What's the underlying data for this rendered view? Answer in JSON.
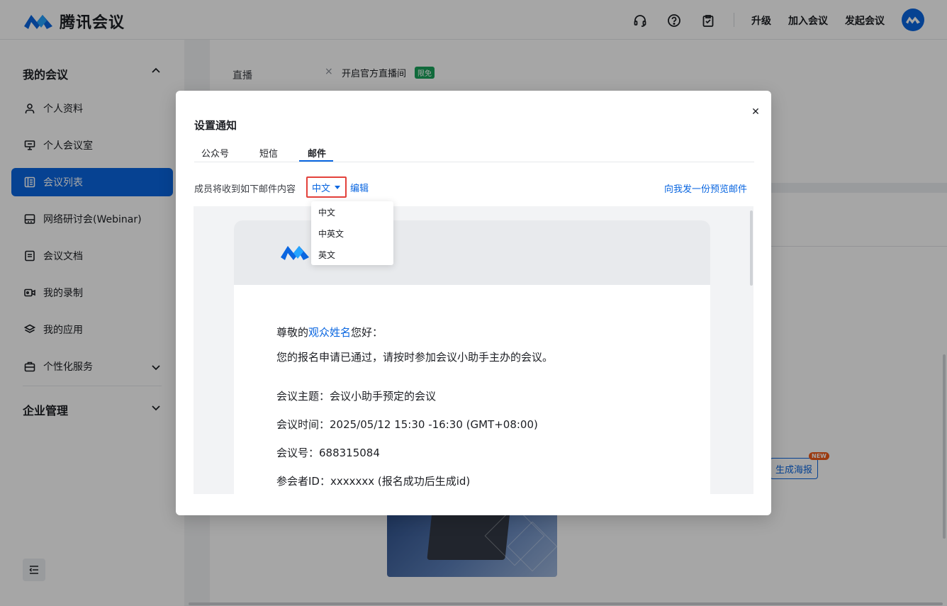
{
  "app": {
    "name": "腾讯会议"
  },
  "topbar": {
    "upgrade": "升级",
    "join": "加入会议",
    "start": "发起会议"
  },
  "sidebar": {
    "my_meetings": "我的会议",
    "items": [
      {
        "label": "个人资料",
        "icon": "user-icon"
      },
      {
        "label": "个人会议室",
        "icon": "monitor-icon"
      },
      {
        "label": "会议列表",
        "icon": "list-icon",
        "active": true
      },
      {
        "label": "网络研讨会(Webinar)",
        "icon": "webinar-icon"
      },
      {
        "label": "会议文档",
        "icon": "document-icon"
      },
      {
        "label": "我的录制",
        "icon": "video-icon"
      },
      {
        "label": "我的应用",
        "icon": "layers-icon"
      },
      {
        "label": "个性化服务",
        "icon": "briefcase-icon"
      }
    ],
    "enterprise": "企业管理"
  },
  "main": {
    "live_label": "直播",
    "live_option": "开启官方直播间",
    "live_badge": "限免",
    "poster_button": "生成海报",
    "new_badge": "NEW"
  },
  "modal": {
    "title": "设置通知",
    "tabs": [
      "公众号",
      "短信",
      "邮件"
    ],
    "active_tab": "邮件",
    "description": "成员将收到如下邮件内容",
    "language_selected": "中文",
    "edit": "编辑",
    "preview_link": "向我发一份预览邮件",
    "language_options": [
      "中文",
      "中英文",
      "英文"
    ],
    "email": {
      "greeting_prefix": "尊敬的",
      "greeting_name": "观众姓名",
      "greeting_suffix": "您好：",
      "approved": "您的报名申请已通过，请按时参加会议小助手主办的会议。",
      "topic": "会议主题：会议小助手预定的会议",
      "time": "会议时间：2025/05/12 15:30 -16:30 (GMT+08:00)",
      "meeting_id": "会议号：688315084",
      "participant_id": "参会者ID：xxxxxxx (报名成功后生成id)"
    }
  },
  "colors": {
    "accent": "#0a66e0",
    "highlight_border": "#e3413b",
    "badge_green": "#1aa35b",
    "badge_orange": "#f05a1a"
  }
}
